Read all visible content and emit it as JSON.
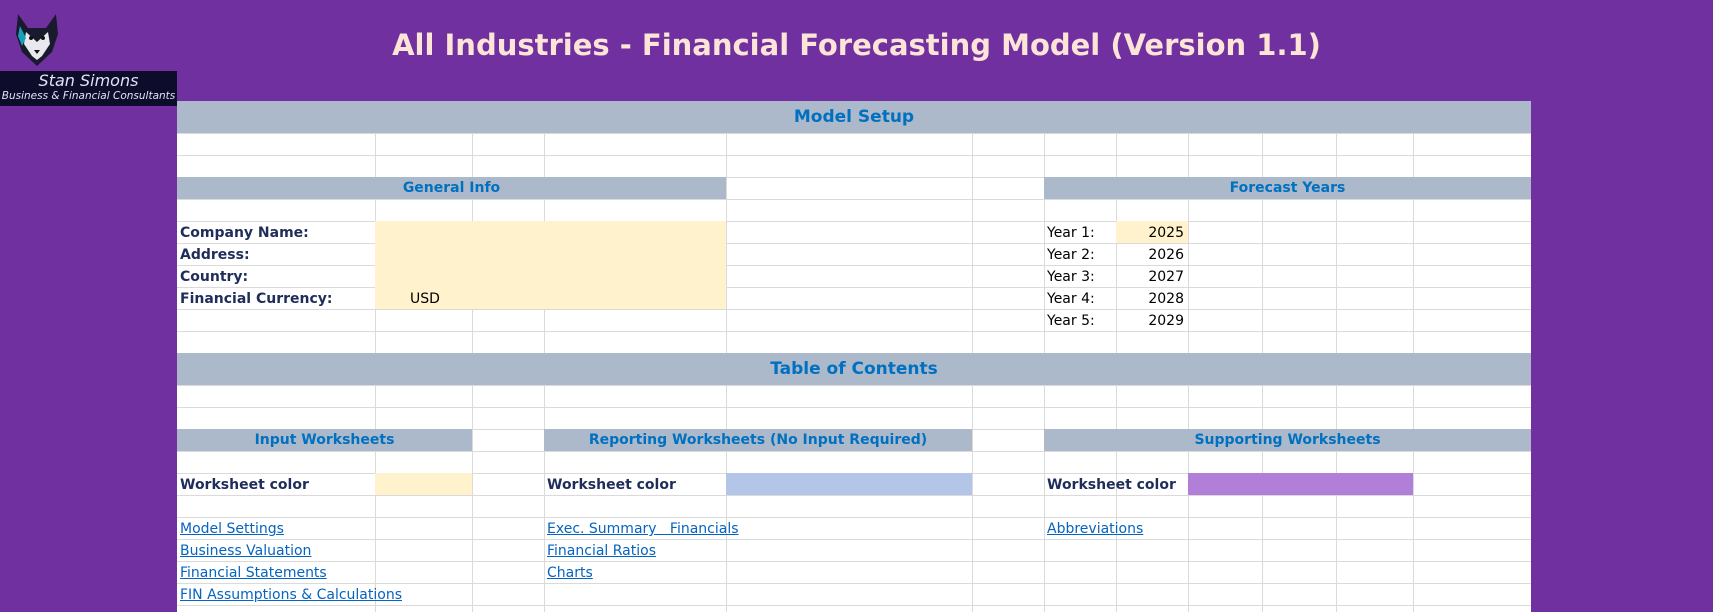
{
  "header": {
    "title": "All Industries - Financial Forecasting Model (Version 1.1)",
    "logo_name": "Stan Simons",
    "logo_tagline": "Business & Financial Consultants"
  },
  "colors": {
    "background": "#7030a0",
    "title_text": "#fce4d6",
    "section_band": "#acb9ca",
    "section_text": "#0070c0",
    "input_fill": "#fff2cc",
    "reporting_fill": "#b4c6e7",
    "supporting_fill": "#b17fd8",
    "link": "#0563c1"
  },
  "model_setup": {
    "heading": "Model Setup",
    "general_info": {
      "heading": "General Info",
      "fields": [
        {
          "label": "Company Name:",
          "value": ""
        },
        {
          "label": "Address:",
          "value": ""
        },
        {
          "label": "Country:",
          "value": ""
        },
        {
          "label": "Financial Currency:",
          "value": "USD"
        }
      ]
    },
    "forecast_years": {
      "heading": "Forecast Years",
      "years": [
        {
          "label": "Year 1:",
          "value": "2025"
        },
        {
          "label": "Year 2:",
          "value": "2026"
        },
        {
          "label": "Year 3:",
          "value": "2027"
        },
        {
          "label": "Year 4:",
          "value": "2028"
        },
        {
          "label": "Year 5:",
          "value": "2029"
        }
      ]
    }
  },
  "toc": {
    "heading": "Table of Contents",
    "input": {
      "heading": "Input Worksheets",
      "color_label": "Worksheet color",
      "links": [
        "Model Settings",
        "Business Valuation",
        "Financial Statements",
        "FIN Assumptions & Calculations"
      ]
    },
    "reporting": {
      "heading": "Reporting Worksheets (No Input Required)",
      "color_label": "Worksheet color",
      "links": [
        "Exec. Summary   Financials",
        "Financial Ratios",
        "Charts"
      ]
    },
    "supporting": {
      "heading": "Supporting Worksheets",
      "color_label": "Worksheet color",
      "links": [
        "Abbreviations"
      ]
    }
  }
}
